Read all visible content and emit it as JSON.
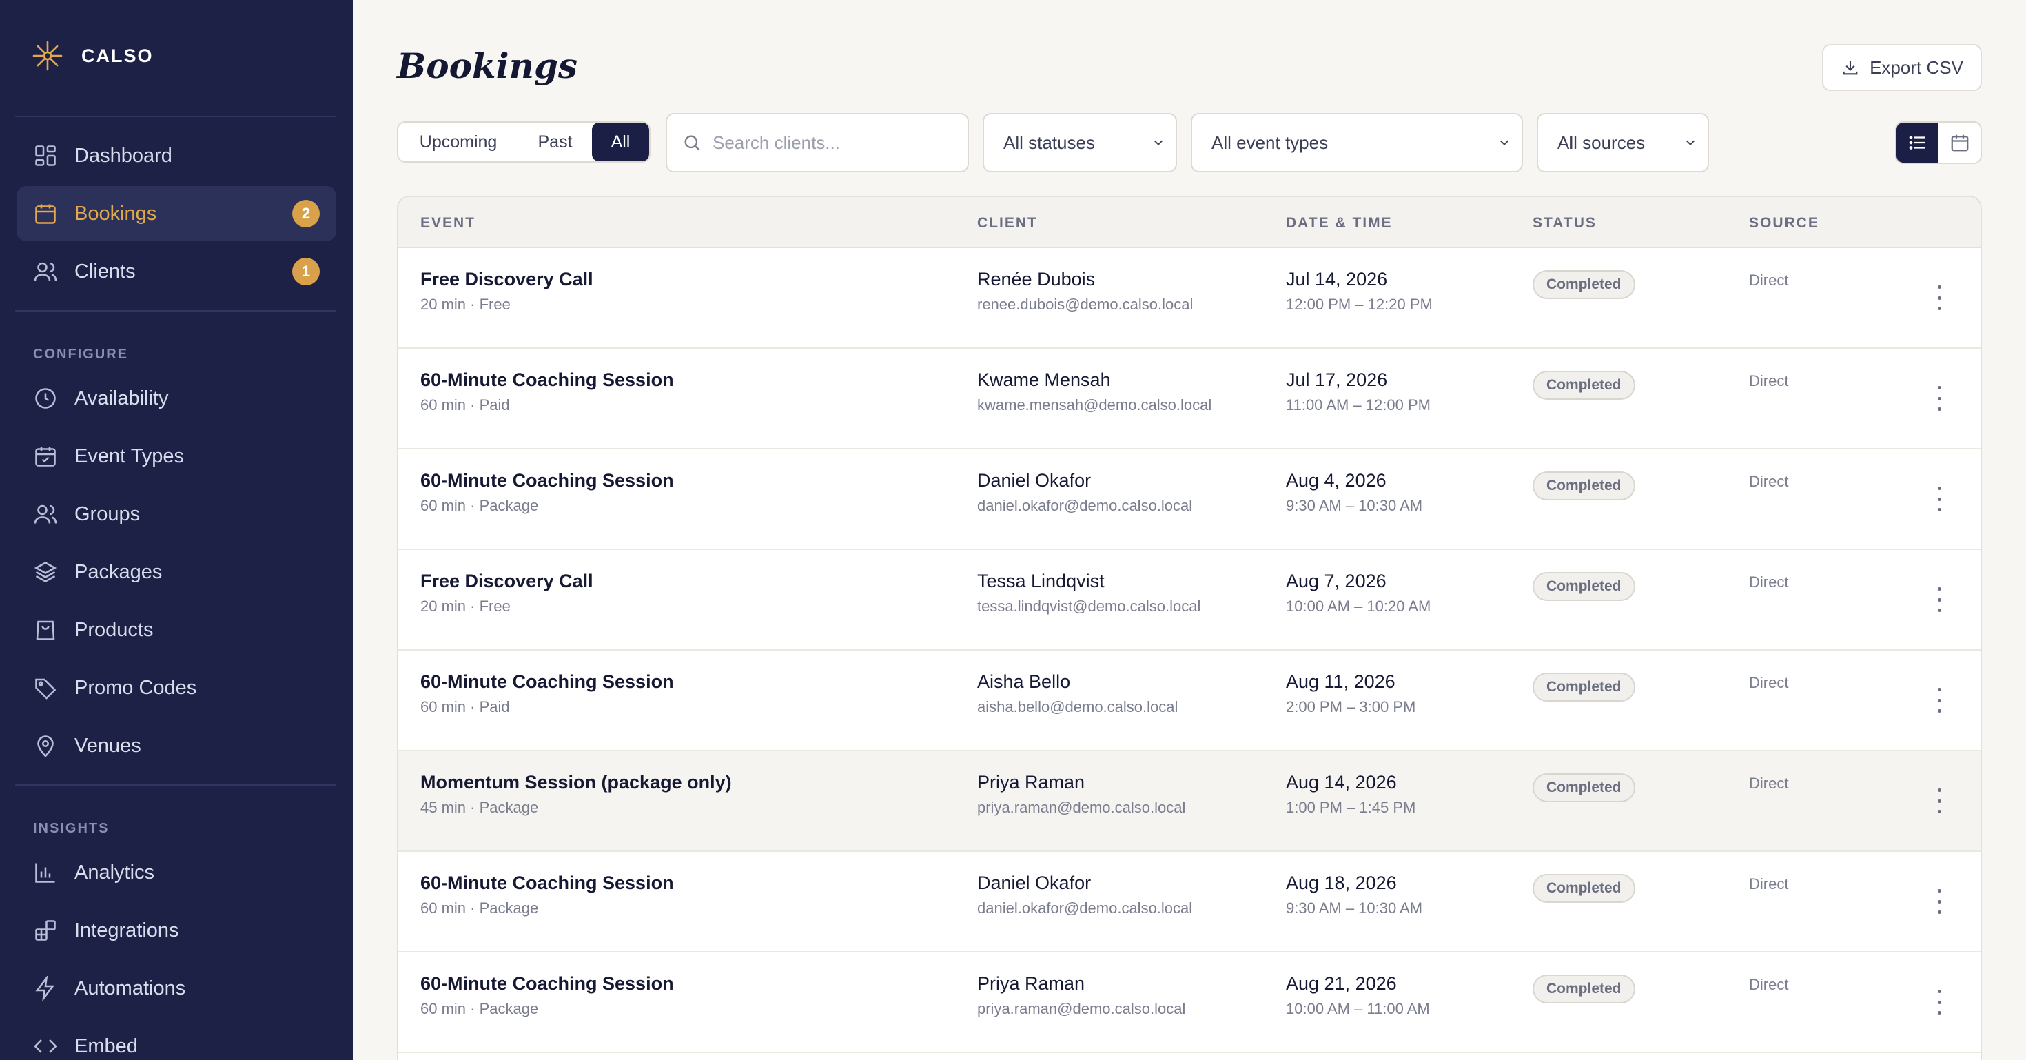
{
  "app": {
    "brand": "CALSO"
  },
  "sidebar": {
    "main_items": [
      {
        "label": "Dashboard",
        "icon": "dashboard-icon"
      },
      {
        "label": "Bookings",
        "icon": "calendar-icon",
        "badge": "2",
        "active": true
      },
      {
        "label": "Clients",
        "icon": "users-icon",
        "badge": "1"
      }
    ],
    "configure_label": "CONFIGURE",
    "configure_items": [
      {
        "label": "Availability",
        "icon": "clock-icon"
      },
      {
        "label": "Event Types",
        "icon": "calendar-check-icon"
      },
      {
        "label": "Groups",
        "icon": "group-icon"
      },
      {
        "label": "Packages",
        "icon": "layers-icon"
      },
      {
        "label": "Products",
        "icon": "shopping-bag-icon"
      },
      {
        "label": "Promo Codes",
        "icon": "tag-icon"
      },
      {
        "label": "Venues",
        "icon": "map-pin-icon"
      }
    ],
    "insights_label": "INSIGHTS",
    "insights_items": [
      {
        "label": "Analytics",
        "icon": "bar-chart-icon"
      },
      {
        "label": "Integrations",
        "icon": "integrations-icon"
      },
      {
        "label": "Automations",
        "icon": "lightning-icon"
      },
      {
        "label": "Embed",
        "icon": "code-icon"
      }
    ]
  },
  "header": {
    "title": "Bookings",
    "export_label": "Export CSV"
  },
  "filters": {
    "segments": [
      "Upcoming",
      "Past",
      "All"
    ],
    "selected_segment": "All",
    "search_placeholder": "Search clients...",
    "status_select": "All statuses",
    "event_type_select": "All event types",
    "source_select": "All sources",
    "view_mode": "list"
  },
  "table": {
    "columns": [
      "EVENT",
      "CLIENT",
      "DATE & TIME",
      "STATUS",
      "SOURCE"
    ],
    "rows": [
      {
        "event": "Free Discovery Call",
        "event_meta": "20 min · Free",
        "client": "Renée Dubois",
        "email": "renee.dubois@demo.calso.local",
        "date": "Jul 14, 2026",
        "time": "12:00 PM – 12:20 PM",
        "status": "Completed",
        "source": "Direct"
      },
      {
        "event": "60-Minute Coaching Session",
        "event_meta": "60 min · Paid",
        "client": "Kwame Mensah",
        "email": "kwame.mensah@demo.calso.local",
        "date": "Jul 17, 2026",
        "time": "11:00 AM – 12:00 PM",
        "status": "Completed",
        "source": "Direct"
      },
      {
        "event": "60-Minute Coaching Session",
        "event_meta": "60 min · Package",
        "client": "Daniel Okafor",
        "email": "daniel.okafor@demo.calso.local",
        "date": "Aug 4, 2026",
        "time": "9:30 AM – 10:30 AM",
        "status": "Completed",
        "source": "Direct"
      },
      {
        "event": "Free Discovery Call",
        "event_meta": "20 min · Free",
        "client": "Tessa Lindqvist",
        "email": "tessa.lindqvist@demo.calso.local",
        "date": "Aug 7, 2026",
        "time": "10:00 AM – 10:20 AM",
        "status": "Completed",
        "source": "Direct"
      },
      {
        "event": "60-Minute Coaching Session",
        "event_meta": "60 min · Paid",
        "client": "Aisha Bello",
        "email": "aisha.bello@demo.calso.local",
        "date": "Aug 11, 2026",
        "time": "2:00 PM – 3:00 PM",
        "status": "Completed",
        "source": "Direct"
      },
      {
        "event": "Momentum Session (package only)",
        "event_meta": "45 min · Package",
        "client": "Priya Raman",
        "email": "priya.raman@demo.calso.local",
        "date": "Aug 14, 2026",
        "time": "1:00 PM – 1:45 PM",
        "status": "Completed",
        "source": "Direct",
        "highlighted": true
      },
      {
        "event": "60-Minute Coaching Session",
        "event_meta": "60 min · Package",
        "client": "Daniel Okafor",
        "email": "daniel.okafor@demo.calso.local",
        "date": "Aug 18, 2026",
        "time": "9:30 AM – 10:30 AM",
        "status": "Completed",
        "source": "Direct"
      },
      {
        "event": "60-Minute Coaching Session",
        "event_meta": "60 min · Package",
        "client": "Priya Raman",
        "email": "priya.raman@demo.calso.local",
        "date": "Aug 21, 2026",
        "time": "10:00 AM – 11:00 AM",
        "status": "Completed",
        "source": "Direct"
      }
    ]
  },
  "colors": {
    "sidebar_bg": "#1d2146",
    "accent": "#e2a84d",
    "active_toggle": "#1b1f45",
    "page_bg": "#f7f6f3"
  }
}
